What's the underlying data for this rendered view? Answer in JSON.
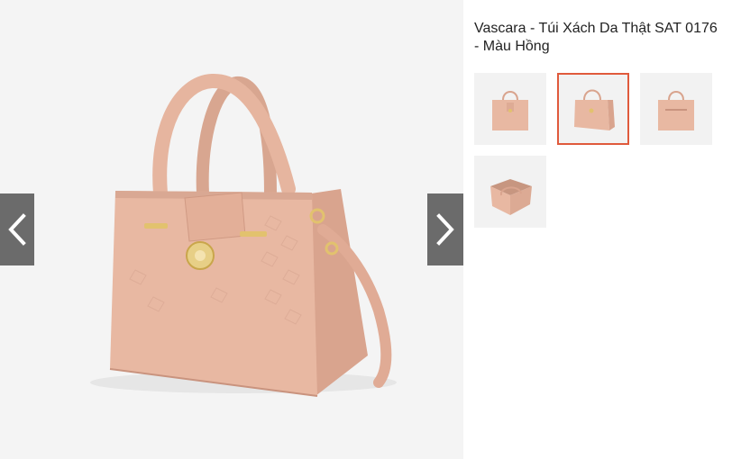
{
  "product": {
    "title": "Vascara - Túi Xách Da Thật SAT 0176 - Màu Hồng",
    "main_image_alt": "Vascara - Túi Xách Da Thật SAT 0176 - Màu Hồng"
  },
  "gallery": {
    "thumbnail_count": 4,
    "active_thumbnail": 2
  },
  "colors": {
    "bag": "#e8b8a2",
    "bag_shade": "#d9a48e",
    "hardware": "#e2c26e",
    "active_border": "#e05a3c",
    "arrow_bg": "#6b6b6b"
  },
  "icons": {
    "prev": "chevron-left-icon",
    "next": "chevron-right-icon"
  }
}
